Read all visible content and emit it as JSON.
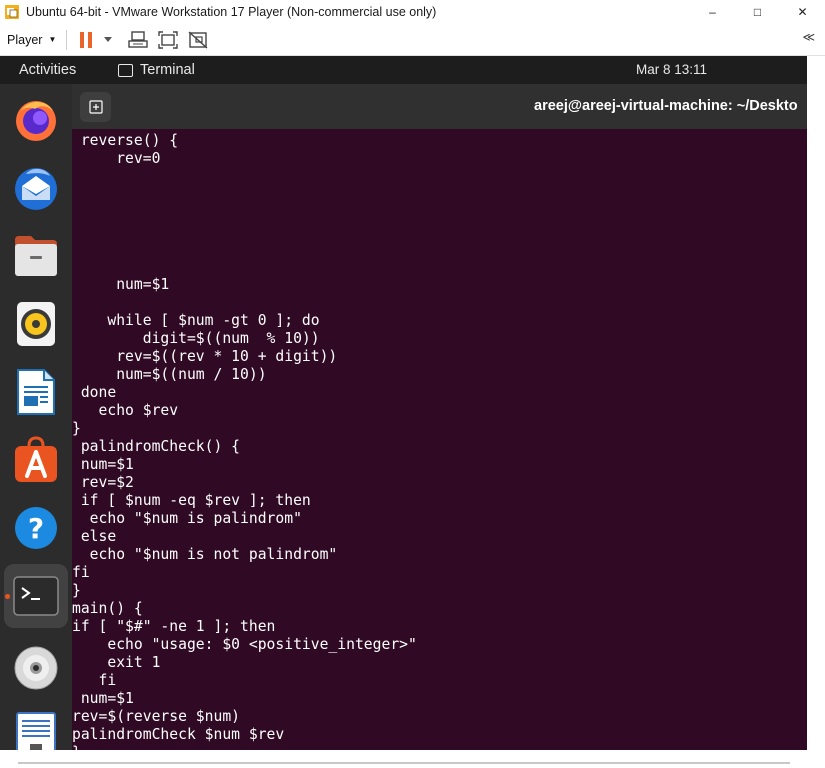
{
  "window": {
    "title": "Ubuntu 64-bit - VMware Workstation 17 Player (Non-commercial use only)",
    "controls": {
      "minimize": "–",
      "maximize": "□",
      "close": "✕"
    }
  },
  "toolbar": {
    "player_label": "Player",
    "player_caret": "▼",
    "collapse": "≪",
    "icons": [
      "pause-icon",
      "send-ctrl-alt-del-icon",
      "fit-guest-icon",
      "unity-icon"
    ]
  },
  "gnome": {
    "activities": "Activities",
    "app_name": "Terminal",
    "clock": "Mar 8  13:11"
  },
  "dock": {
    "items": [
      "firefox",
      "thunderbird",
      "files",
      "rhythmbox",
      "libreoffice-writer",
      "ubuntu-software",
      "help",
      "terminal",
      "dvd",
      "text-editor"
    ],
    "active": "terminal"
  },
  "terminal": {
    "title": "areej@areej-virtual-machine: ~/Deskto",
    "lines": [
      " reverse() {",
      "     rev=0",
      "",
      "",
      "",
      "",
      "",
      "",
      "     num=$1",
      "",
      "    while [ $num -gt 0 ]; do",
      "        digit=$((num  % 10))",
      "     rev=$((rev * 10 + digit))",
      "     num=$((num / 10))",
      " done",
      "   echo $rev",
      "}",
      " palindromCheck() {",
      " num=$1",
      " rev=$2",
      " if [ $num -eq $rev ]; then",
      "  echo \"$num is palindrom\"",
      " else",
      "  echo \"$num is not palindrom\"",
      "fi",
      "}",
      "main() {",
      "if [ \"$#\" -ne 1 ]; then",
      "    echo \"usage: $0 <positive_integer>\"",
      "    exit 1",
      "   fi",
      " num=$1",
      "rev=$(reverse $num)",
      "palindromCheck $num $rev",
      "}"
    ]
  },
  "colors": {
    "terminal_bg": "#300a24",
    "dock_bg": "#2c2c2c",
    "topbar_bg": "#1d1d1d",
    "accent": "#e95420"
  }
}
